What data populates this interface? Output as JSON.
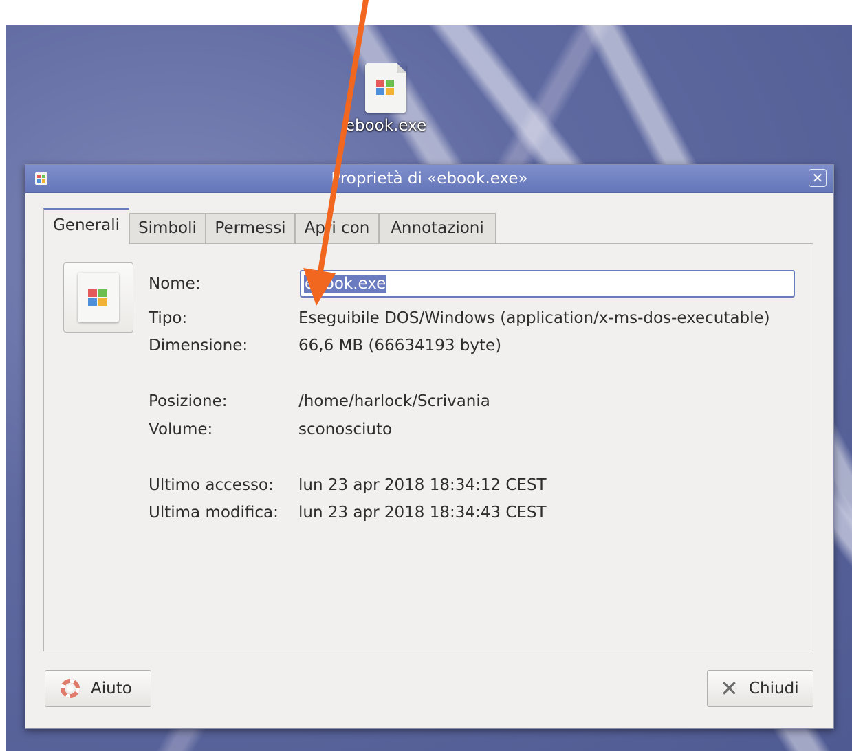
{
  "desktop": {
    "icon_label": "ebook.exe",
    "icon_name": "exe-file-icon"
  },
  "dialog": {
    "title": "Proprietà di «ebook.exe»",
    "close_glyph": "✕",
    "accent": "#6a7bc0",
    "tabs": [
      {
        "label": "Generali",
        "active": true
      },
      {
        "label": "Simboli",
        "active": false
      },
      {
        "label": "Permessi",
        "active": false
      },
      {
        "label": "Apri con",
        "active": false
      },
      {
        "label": "Annotazioni",
        "active": false
      }
    ],
    "fields": {
      "name_label": "Nome:",
      "name_value": "ebook.exe",
      "type_label": "Tipo:",
      "type_value": "Eseguibile DOS/Windows (application/x-ms-dos-executable)",
      "size_label": "Dimensione:",
      "size_value": "66,6 MB (66634193 byte)",
      "location_label": "Posizione:",
      "location_value": "/home/harlock/Scrivania",
      "volume_label": "Volume:",
      "volume_value": "sconosciuto",
      "accessed_label": "Ultimo accesso:",
      "accessed_value": "lun 23 apr 2018 18:34:12 CEST",
      "modified_label": "Ultima modifica:",
      "modified_value": "lun 23 apr 2018 18:34:43 CEST"
    },
    "buttons": {
      "help_label": "Aiuto",
      "close_label": "Chiudi"
    }
  },
  "annotation": {
    "arrow_color": "#f2671f"
  }
}
